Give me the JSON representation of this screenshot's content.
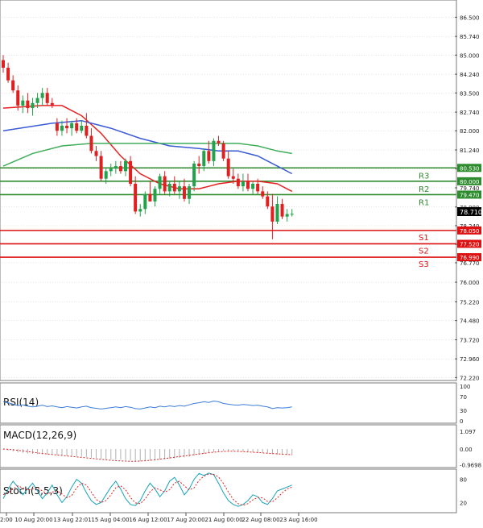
{
  "colors": {
    "bull": "#22a34a",
    "bear": "#e02020",
    "ema_fast": "#e82222",
    "ema_mid": "#3b5bd6",
    "ema_slow": "#3fae5a",
    "resistance": "#2e8b2e",
    "support": "#dd1111",
    "rsi_line": "#3b7dd8",
    "macd_hist": "#b0b0b0",
    "macd_signal": "#e02020",
    "stoch_k": "#17a3b8",
    "stoch_d": "#e02020",
    "grid": "#cccccc",
    "axis": "#555555"
  },
  "chart_data": {
    "type": "candlestick",
    "price_axis": {
      "ylim": [
        72.2,
        86.8
      ],
      "ticks": [
        "86.500",
        "85.740",
        "85.000",
        "84.240",
        "83.500",
        "82.740",
        "82.000",
        "81.240",
        "80.500",
        "79.740",
        "78.980",
        "78.240",
        "77.500",
        "76.770",
        "76.000",
        "75.220",
        "74.480",
        "73.720",
        "72.960",
        "72.220"
      ],
      "current_price": "78.710"
    },
    "x_labels": [
      "2:00",
      "10 Aug 20:00",
      "13 Aug 22:01",
      "15 Aug 04:00",
      "16 Aug 12:00",
      "17 Aug 20:00",
      "21 Aug 00:00",
      "22 Aug 08:00",
      "23 Aug 16:00"
    ],
    "levels": [
      {
        "name": "R3",
        "value": "80.530",
        "kind": "resistance"
      },
      {
        "name": "R2",
        "value": "80.000",
        "kind": "resistance"
      },
      {
        "name": "R1",
        "value": "79.470",
        "kind": "resistance"
      },
      {
        "name": "S1",
        "value": "78.050",
        "kind": "support"
      },
      {
        "name": "S2",
        "value": "77.520",
        "kind": "support"
      },
      {
        "name": "S3",
        "value": "76.990",
        "kind": "support"
      }
    ],
    "candles": [
      [
        84.8,
        85.0,
        84.3,
        84.5
      ],
      [
        84.5,
        84.7,
        83.9,
        84.0
      ],
      [
        84.0,
        84.2,
        83.5,
        83.6
      ],
      [
        83.6,
        83.8,
        82.8,
        83.0
      ],
      [
        83.0,
        83.4,
        82.7,
        83.2
      ],
      [
        83.2,
        83.5,
        82.7,
        82.9
      ],
      [
        82.9,
        83.3,
        82.6,
        83.1
      ],
      [
        83.1,
        83.5,
        82.9,
        83.3
      ],
      [
        83.3,
        83.7,
        83.0,
        83.5
      ],
      [
        83.5,
        83.7,
        83.0,
        83.1
      ],
      [
        83.1,
        83.3,
        82.9,
        83.0
      ],
      [
        82.3,
        82.5,
        81.8,
        82.0
      ],
      [
        82.0,
        82.4,
        81.8,
        82.2
      ],
      [
        82.2,
        82.5,
        81.9,
        82.1
      ],
      [
        82.1,
        82.4,
        81.8,
        82.3
      ],
      [
        82.3,
        82.5,
        81.9,
        82.0
      ],
      [
        82.0,
        82.4,
        81.9,
        82.2
      ],
      [
        82.2,
        82.7,
        81.7,
        81.8
      ],
      [
        81.8,
        82.1,
        81.1,
        81.2
      ],
      [
        81.2,
        81.4,
        80.8,
        81.0
      ],
      [
        81.0,
        81.2,
        80.0,
        80.1
      ],
      [
        80.1,
        80.5,
        79.9,
        80.4
      ],
      [
        80.4,
        80.7,
        80.2,
        80.5
      ],
      [
        80.5,
        80.8,
        80.3,
        80.6
      ],
      [
        80.6,
        80.8,
        80.3,
        80.4
      ],
      [
        80.4,
        80.9,
        80.2,
        80.8
      ],
      [
        80.8,
        81.0,
        79.8,
        79.9
      ],
      [
        79.9,
        80.2,
        78.7,
        78.8
      ],
      [
        78.8,
        79.1,
        78.6,
        78.9
      ],
      [
        78.9,
        79.6,
        78.7,
        79.5
      ],
      [
        79.5,
        80.0,
        79.2,
        79.2
      ],
      [
        79.2,
        79.8,
        79.0,
        79.7
      ],
      [
        79.7,
        80.3,
        79.5,
        80.2
      ],
      [
        80.2,
        80.4,
        79.5,
        79.6
      ],
      [
        79.6,
        80.0,
        79.4,
        79.9
      ],
      [
        79.9,
        80.2,
        79.5,
        79.6
      ],
      [
        79.6,
        80.0,
        79.3,
        79.8
      ],
      [
        79.8,
        80.1,
        79.2,
        79.3
      ],
      [
        79.3,
        79.9,
        79.1,
        79.8
      ],
      [
        79.8,
        80.8,
        79.6,
        80.7
      ],
      [
        80.7,
        81.0,
        80.3,
        80.6
      ],
      [
        80.6,
        81.3,
        80.4,
        81.2
      ],
      [
        81.2,
        81.6,
        80.7,
        80.8
      ],
      [
        80.8,
        81.7,
        80.6,
        81.6
      ],
      [
        81.6,
        81.8,
        81.4,
        81.5
      ],
      [
        81.5,
        81.6,
        80.8,
        80.9
      ],
      [
        80.9,
        81.2,
        80.1,
        80.2
      ],
      [
        80.2,
        80.5,
        79.9,
        80.1
      ],
      [
        80.1,
        80.3,
        79.7,
        79.8
      ],
      [
        79.8,
        80.3,
        79.6,
        80.0
      ],
      [
        80.0,
        80.3,
        79.6,
        79.7
      ],
      [
        79.7,
        80.0,
        79.5,
        79.9
      ],
      [
        79.9,
        80.1,
        79.5,
        79.6
      ],
      [
        79.6,
        79.8,
        79.3,
        79.4
      ],
      [
        79.4,
        79.6,
        78.9,
        79.0
      ],
      [
        79.0,
        79.5,
        77.7,
        78.4
      ],
      [
        78.4,
        79.4,
        78.3,
        79.1
      ],
      [
        79.1,
        79.3,
        78.5,
        78.6
      ],
      [
        78.6,
        78.9,
        78.4,
        78.7
      ],
      [
        78.7,
        78.9,
        78.6,
        78.71
      ]
    ],
    "moving_averages": [
      {
        "color_key": "ema_fast",
        "values": [
          [
            0,
            82.9
          ],
          [
            8,
            83.0
          ],
          [
            12,
            83.0
          ],
          [
            16,
            82.6
          ],
          [
            20,
            81.9
          ],
          [
            24,
            81.0
          ],
          [
            28,
            80.3
          ],
          [
            32,
            79.9
          ],
          [
            36,
            79.7
          ],
          [
            40,
            79.7
          ],
          [
            44,
            79.9
          ],
          [
            48,
            80.0
          ],
          [
            52,
            80.0
          ],
          [
            56,
            79.9
          ],
          [
            59,
            79.6
          ]
        ]
      },
      {
        "color_key": "ema_mid",
        "values": [
          [
            0,
            82.0
          ],
          [
            10,
            82.3
          ],
          [
            16,
            82.4
          ],
          [
            22,
            82.1
          ],
          [
            28,
            81.7
          ],
          [
            34,
            81.4
          ],
          [
            40,
            81.3
          ],
          [
            44,
            81.2
          ],
          [
            48,
            81.2
          ],
          [
            52,
            81.0
          ],
          [
            56,
            80.6
          ],
          [
            59,
            80.3
          ]
        ]
      },
      {
        "color_key": "ema_slow",
        "values": [
          [
            0,
            80.6
          ],
          [
            6,
            81.1
          ],
          [
            12,
            81.4
          ],
          [
            18,
            81.5
          ],
          [
            24,
            81.5
          ],
          [
            30,
            81.5
          ],
          [
            36,
            81.5
          ],
          [
            42,
            81.5
          ],
          [
            48,
            81.5
          ],
          [
            52,
            81.4
          ],
          [
            56,
            81.2
          ],
          [
            59,
            81.1
          ]
        ]
      }
    ],
    "indicators": {
      "rsi": {
        "label": "RSI(14)",
        "ylim": [
          0,
          100
        ],
        "ticks": [
          "100",
          "70",
          "30",
          "0"
        ],
        "values": [
          55,
          52,
          48,
          44,
          46,
          42,
          40,
          42,
          45,
          41,
          43,
          40,
          38,
          41,
          39,
          37,
          40,
          42,
          38,
          36,
          34,
          36,
          38,
          40,
          38,
          41,
          39,
          35,
          34,
          37,
          40,
          38,
          42,
          40,
          43,
          41,
          44,
          42,
          46,
          50,
          52,
          55,
          53,
          57,
          55,
          50,
          48,
          46,
          45,
          47,
          46,
          44,
          45,
          42,
          40,
          35,
          38,
          37,
          38,
          40
        ]
      },
      "macd": {
        "label": "MACD(12,26,9)",
        "ylim": [
          -1.0,
          1.3
        ],
        "ticks": [
          "1.097",
          "0.00",
          "-0.9698"
        ],
        "histogram": [
          -0.05,
          -0.1,
          -0.15,
          -0.2,
          -0.25,
          -0.28,
          -0.3,
          -0.32,
          -0.33,
          -0.35,
          -0.36,
          -0.38,
          -0.4,
          -0.42,
          -0.44,
          -0.46,
          -0.48,
          -0.5,
          -0.53,
          -0.56,
          -0.6,
          -0.62,
          -0.64,
          -0.65,
          -0.66,
          -0.68,
          -0.7,
          -0.74,
          -0.76,
          -0.75,
          -0.73,
          -0.7,
          -0.66,
          -0.64,
          -0.6,
          -0.58,
          -0.55,
          -0.52,
          -0.48,
          -0.42,
          -0.36,
          -0.3,
          -0.25,
          -0.2,
          -0.15,
          -0.12,
          -0.11,
          -0.12,
          -0.14,
          -0.16,
          -0.18,
          -0.2,
          -0.22,
          -0.24,
          -0.27,
          -0.32,
          -0.34,
          -0.36,
          -0.37,
          -0.38
        ],
        "signal": [
          0.0,
          -0.02,
          -0.05,
          -0.08,
          -0.12,
          -0.16,
          -0.2,
          -0.24,
          -0.28,
          -0.31,
          -0.34,
          -0.37,
          -0.4,
          -0.43,
          -0.46,
          -0.49,
          -0.52,
          -0.55,
          -0.58,
          -0.61,
          -0.64,
          -0.67,
          -0.7,
          -0.72,
          -0.74,
          -0.75,
          -0.76,
          -0.76,
          -0.75,
          -0.73,
          -0.7,
          -0.67,
          -0.63,
          -0.59,
          -0.55,
          -0.51,
          -0.47,
          -0.43,
          -0.39,
          -0.35,
          -0.31,
          -0.27,
          -0.23,
          -0.2,
          -0.17,
          -0.15,
          -0.14,
          -0.14,
          -0.15,
          -0.16,
          -0.18,
          -0.2,
          -0.22,
          -0.24,
          -0.26,
          -0.28,
          -0.3,
          -0.32,
          -0.34,
          -0.35
        ]
      },
      "stoch": {
        "label": "Stoch(5,5,3)",
        "ylim": [
          0,
          100
        ],
        "ticks": [
          "80",
          "20"
        ],
        "k": [
          30,
          55,
          75,
          60,
          40,
          55,
          70,
          50,
          30,
          45,
          65,
          40,
          20,
          35,
          60,
          80,
          70,
          45,
          25,
          15,
          20,
          40,
          60,
          75,
          55,
          30,
          15,
          12,
          25,
          50,
          70,
          55,
          35,
          50,
          75,
          85,
          65,
          40,
          55,
          80,
          95,
          90,
          96,
          92,
          70,
          45,
          25,
          15,
          10,
          15,
          25,
          40,
          35,
          20,
          15,
          30,
          50,
          55,
          60,
          65
        ],
        "d": [
          40,
          45,
          55,
          63,
          58,
          52,
          55,
          58,
          50,
          42,
          47,
          50,
          42,
          32,
          38,
          58,
          70,
          65,
          47,
          28,
          20,
          25,
          40,
          58,
          63,
          53,
          33,
          19,
          17,
          29,
          48,
          58,
          53,
          47,
          53,
          70,
          75,
          63,
          53,
          58,
          77,
          88,
          94,
          93,
          86,
          69,
          47,
          28,
          17,
          13,
          17,
          27,
          33,
          32,
          23,
          22,
          32,
          45,
          55,
          60
        ]
      }
    }
  }
}
